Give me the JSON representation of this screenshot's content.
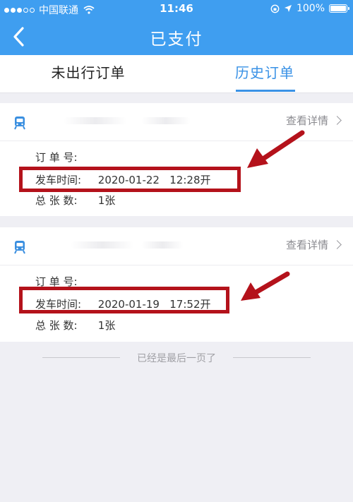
{
  "status_bar": {
    "carrier": "中国联通",
    "time": "11:46",
    "battery": "100%"
  },
  "header": {
    "title": "已支付"
  },
  "tabs": [
    {
      "label": "未出行订单",
      "active": false
    },
    {
      "label": "历史订单",
      "active": true
    }
  ],
  "orders": [
    {
      "detail_label": "查看详情",
      "order_no_label": "订 单 号:",
      "departure_label": "发车时间:",
      "departure_value": "2020-01-22   12:28开",
      "tickets_label": "总 张 数:",
      "tickets_value": "1张"
    },
    {
      "detail_label": "查看详情",
      "order_no_label": "订 单 号:",
      "departure_label": "发车时间:",
      "departure_value": "2020-01-19   17:52开",
      "tickets_label": "总 张 数:",
      "tickets_value": "1张"
    }
  ],
  "footer": {
    "end_text": "已经是最后一页了"
  },
  "colors": {
    "header_blue": "#3f9ef0",
    "tab_active": "#3a92e6",
    "highlight_red": "#b4121b"
  }
}
